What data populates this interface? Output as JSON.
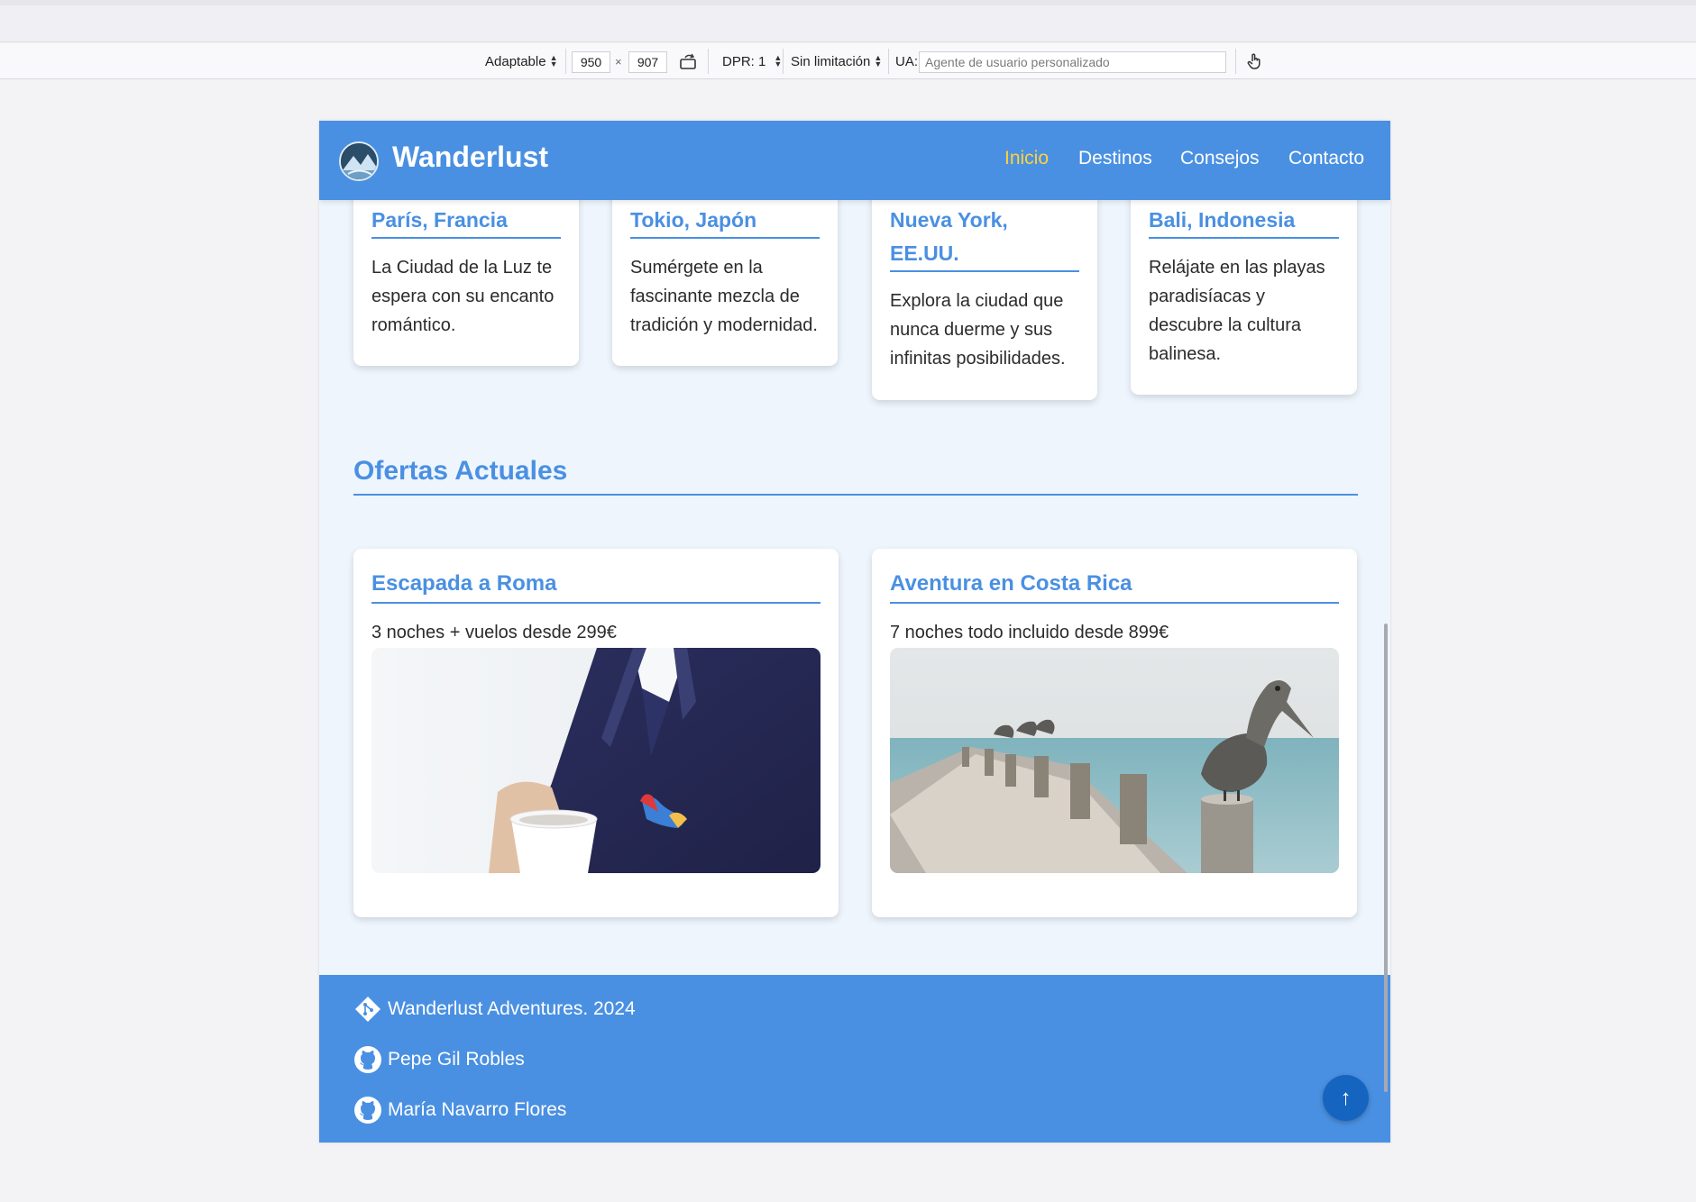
{
  "devtools": {
    "device_mode": "Adaptable",
    "width": "950",
    "times": "×",
    "height": "907",
    "dpr": "DPR: 1",
    "throttle": "Sin limitación",
    "ua_label": "UA:",
    "ua_placeholder": "Agente de usuario personalizado"
  },
  "header": {
    "brand": "Wanderlust",
    "nav": [
      {
        "label": "Inicio",
        "active": true
      },
      {
        "label": "Destinos",
        "active": false
      },
      {
        "label": "Consejos",
        "active": false
      },
      {
        "label": "Contacto",
        "active": false
      }
    ]
  },
  "destinations": [
    {
      "title": "París, Francia",
      "text": "La Ciudad de la Luz te espera con su encanto romántico."
    },
    {
      "title": "Tokio, Japón",
      "text": "Sumérgete en la fascinante mezcla de tradición y modernidad."
    },
    {
      "title": "Nueva York, EE.UU.",
      "text": "Explora la ciudad que nunca duerme y sus infinitas posibilidades."
    },
    {
      "title": "Bali, Indonesia",
      "text": "Relájate en las playas paradisíacas y descubre la cultura balinesa."
    }
  ],
  "offers_section": {
    "title": "Ofertas Actuales"
  },
  "offers": [
    {
      "title": "Escapada a Roma",
      "text": "3 noches + vuelos desde 299€"
    },
    {
      "title": "Aventura en Costa Rica",
      "text": "7 noches todo incluido desde 899€"
    }
  ],
  "footer": {
    "copyright": "Wanderlust Adventures. 2024",
    "authors": [
      "Pepe Gil Robles",
      "María Navarro Flores"
    ],
    "to_top": "↑"
  },
  "colors": {
    "primary": "#4a90e2",
    "active_nav": "#ffd23a",
    "page_bg": "#eef5fd",
    "to_top": "#1565c0"
  }
}
